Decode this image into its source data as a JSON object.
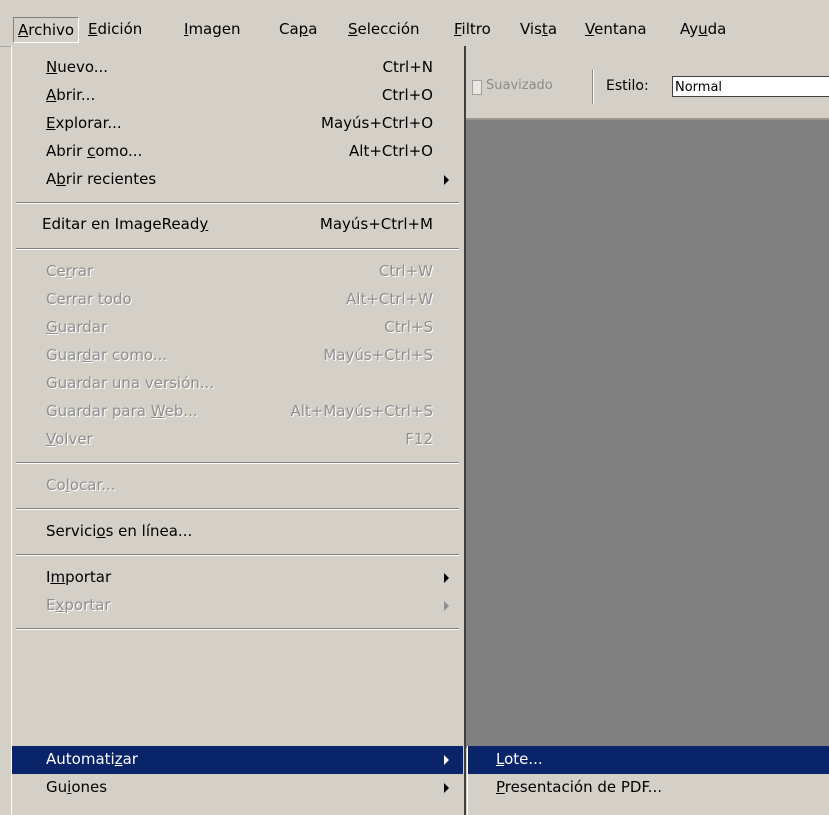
{
  "menubar": {
    "items": [
      {
        "pre": "",
        "key": "A",
        "post": "rchivo",
        "active": true
      },
      {
        "pre": "",
        "key": "E",
        "post": "dición"
      },
      {
        "pre": "",
        "key": "I",
        "post": "magen"
      },
      {
        "pre": "Ca",
        "key": "p",
        "post": "a"
      },
      {
        "pre": "",
        "key": "S",
        "post": "elección"
      },
      {
        "pre": "",
        "key": "F",
        "post": "iltro"
      },
      {
        "pre": "Vis",
        "key": "t",
        "post": "a"
      },
      {
        "pre": "",
        "key": "V",
        "post": "entana"
      },
      {
        "pre": "Ay",
        "key": "u",
        "post": "da"
      }
    ]
  },
  "options": {
    "antialias_label": "Suavizado",
    "style_label": "Estilo:",
    "style_value": "Normal"
  },
  "file_menu": {
    "items": [
      {
        "pre": "",
        "key": "N",
        "post": "uevo...",
        "shortcut": "Ctrl+N"
      },
      {
        "pre": "",
        "key": "A",
        "post": "brir...",
        "shortcut": "Ctrl+O"
      },
      {
        "pre": "",
        "key": "E",
        "post": "xplorar...",
        "shortcut": "Mayús+Ctrl+O"
      },
      {
        "pre": "Abrir ",
        "key": "c",
        "post": "omo...",
        "shortcut": "Alt+Ctrl+O"
      },
      {
        "pre": "A",
        "key": "b",
        "post": "rir recientes",
        "shortcut": "",
        "submenu": true
      },
      {
        "pre": "Editar en ImageRead",
        "key": "y",
        "post": "",
        "shortcut": "Mayús+Ctrl+M"
      },
      {
        "pre": "Ce",
        "key": "r",
        "post": "rar",
        "shortcut": "Ctrl+W",
        "disabled": true
      },
      {
        "pre": "Cerrar todo",
        "key": "",
        "post": "",
        "shortcut": "Alt+Ctrl+W",
        "disabled": true
      },
      {
        "pre": "",
        "key": "G",
        "post": "uardar",
        "shortcut": "Ctrl+S",
        "disabled": true
      },
      {
        "pre": "Guar",
        "key": "d",
        "post": "ar como...",
        "shortcut": "Mayús+Ctrl+S",
        "disabled": true
      },
      {
        "pre": "Guardar una versión...",
        "key": "",
        "post": "",
        "shortcut": "",
        "disabled": true
      },
      {
        "pre": "Guardar para ",
        "key": "W",
        "post": "eb...",
        "shortcut": "Alt+Mayús+Ctrl+S",
        "disabled": true
      },
      {
        "pre": "",
        "key": "V",
        "post": "olver",
        "shortcut": "F12",
        "disabled": true
      },
      {
        "pre": "Co",
        "key": "l",
        "post": "ocar...",
        "shortcut": "",
        "disabled": true
      },
      {
        "pre": "Servici",
        "key": "o",
        "post": "s en línea...",
        "shortcut": ""
      },
      {
        "pre": "I",
        "key": "m",
        "post": "portar",
        "shortcut": "",
        "submenu": true
      },
      {
        "pre": "E",
        "key": "x",
        "post": "portar",
        "shortcut": "",
        "submenu": true,
        "disabled": true
      },
      {
        "pre": "Automati",
        "key": "z",
        "post": "ar",
        "shortcut": "",
        "submenu": true,
        "highlighted": true
      },
      {
        "pre": "Gu",
        "key": "i",
        "post": "ones",
        "shortcut": "",
        "submenu": true
      }
    ]
  },
  "automate_submenu": {
    "items": [
      {
        "pre": "",
        "key": "L",
        "post": "ote...",
        "highlighted": true
      },
      {
        "pre": "",
        "key": "P",
        "post": "resentación de PDF..."
      }
    ]
  }
}
